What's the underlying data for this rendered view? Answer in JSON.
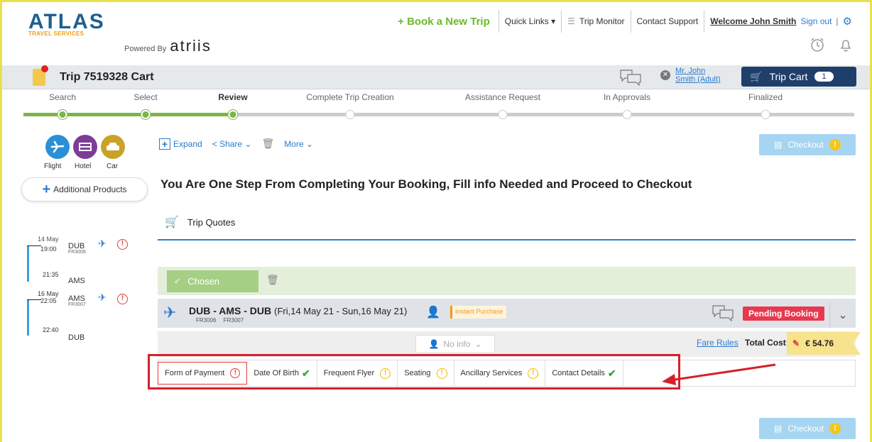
{
  "brand": {
    "logo": "ATLAS",
    "logo_sub": "TRAVEL SERVICES",
    "powered_by": "Powered By",
    "powered_name": "atriis"
  },
  "topnav": {
    "book": "+ Book a New Trip",
    "quick_links": "Quick Links",
    "trip_monitor": "Trip Monitor",
    "contact_support": "Contact Support",
    "welcome": "Welcome John Smith",
    "sign_out": "Sign out",
    "separator": "|"
  },
  "cart": {
    "title": "Trip 7519328 Cart",
    "traveler_line1": "Mr. John",
    "traveler_line2": "Smith (Adult)",
    "trip_cart": "Trip Cart",
    "count": "1"
  },
  "steps": [
    {
      "label": "Search",
      "state": "done"
    },
    {
      "label": "Select",
      "state": "done"
    },
    {
      "label": "Review",
      "state": "active"
    },
    {
      "label": "Complete Trip Creation",
      "state": "pending"
    },
    {
      "label": "Assistance Request",
      "state": "pending"
    },
    {
      "label": "In Approvals",
      "state": "pending"
    },
    {
      "label": "Finalized",
      "state": "pending"
    }
  ],
  "products": [
    {
      "label": "Flight",
      "color": "#2a8fd6"
    },
    {
      "label": "Hotel",
      "color": "#7d3c98"
    },
    {
      "label": "Car",
      "color": "#c9a227"
    }
  ],
  "additional_products": "Additional Products",
  "toolbar": {
    "expand": "Expand",
    "share": "Share",
    "more": "More",
    "checkout": "Checkout"
  },
  "heading": "You Are One Step From Completing Your Booking, Fill info Needed and Proceed to Checkout",
  "trip_quotes": "Trip Quotes",
  "itinerary": [
    {
      "date": "14 May",
      "time": "19:00",
      "from": "DUB",
      "flight": "FR3006",
      "arr_time": "21:35",
      "to": "AMS"
    },
    {
      "date": "16 May",
      "time": "22:05",
      "from": "AMS",
      "flight": "FR3007",
      "arr_time": "22:40",
      "to": "DUB"
    }
  ],
  "chosen": "Chosen",
  "flight": {
    "route": "DUB - AMS - DUB",
    "dates": "(Fri,14 May 21 - Sun,16 May 21)",
    "codes": "FR3006 FR3007",
    "instant": "Instant Purchase",
    "status": "Pending Booking"
  },
  "no_info": "No info",
  "fare_rules": "Fare Rules",
  "total_cost_label": "Total Cost:",
  "total_cost": "€ 54.76",
  "tabs": [
    {
      "label": "Form of Payment",
      "status": "error"
    },
    {
      "label": "Date Of Birth",
      "status": "ok"
    },
    {
      "label": "Frequent Flyer",
      "status": "warn"
    },
    {
      "label": "Seating",
      "status": "warn"
    },
    {
      "label": "Ancillary Services",
      "status": "warn"
    },
    {
      "label": "Contact Details",
      "status": "ok"
    }
  ],
  "colors": {
    "accent": "#2a7ccf",
    "progress": "#7ab648",
    "danger": "#e8384f",
    "highlight": "#d61f2c"
  }
}
